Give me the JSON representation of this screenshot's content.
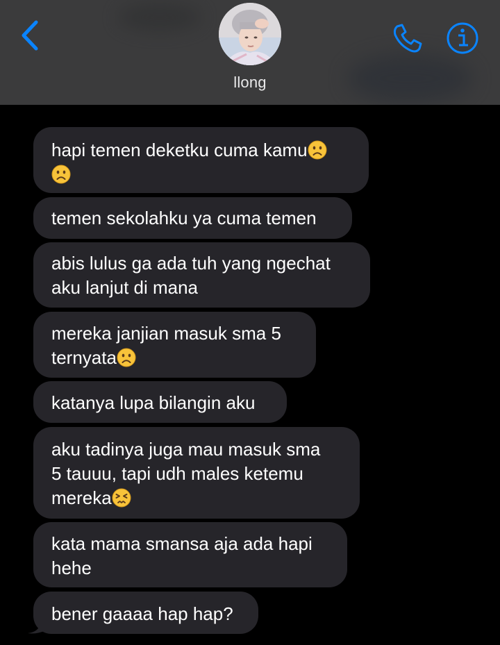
{
  "header": {
    "contact_name": "llong"
  },
  "messages": [
    {
      "lines": [
        "hapi temen deketku cuma kamu",
        ""
      ],
      "emojis": [
        "frowning-face",
        "frowning-face"
      ]
    },
    {
      "lines": [
        "temen sekolahku ya cuma temen"
      ]
    },
    {
      "lines": [
        "abis lulus ga ada tuh yang ngechat",
        "aku lanjut di mana"
      ]
    },
    {
      "lines": [
        "mereka janjian masuk sma 5",
        "ternyata"
      ],
      "emojis": [
        "frowning-face"
      ]
    },
    {
      "lines": [
        "katanya lupa bilangin aku"
      ]
    },
    {
      "lines": [
        "aku tadinya juga mau masuk sma",
        "5 tauuu, tapi udh males ketemu",
        "mereka"
      ],
      "emojis": [
        "persevering-face"
      ]
    },
    {
      "lines": [
        "kata mama smansa aja ada hapi",
        "hehe"
      ]
    },
    {
      "lines": [
        "bener gaaaa hap hap?"
      ]
    }
  ],
  "colors": {
    "accent": "#0a84ff",
    "bubble": "#26252a",
    "header": "#3b3b3c",
    "background": "#000000"
  },
  "icons": [
    "back-chevron-icon",
    "phone-icon",
    "info-icon"
  ]
}
